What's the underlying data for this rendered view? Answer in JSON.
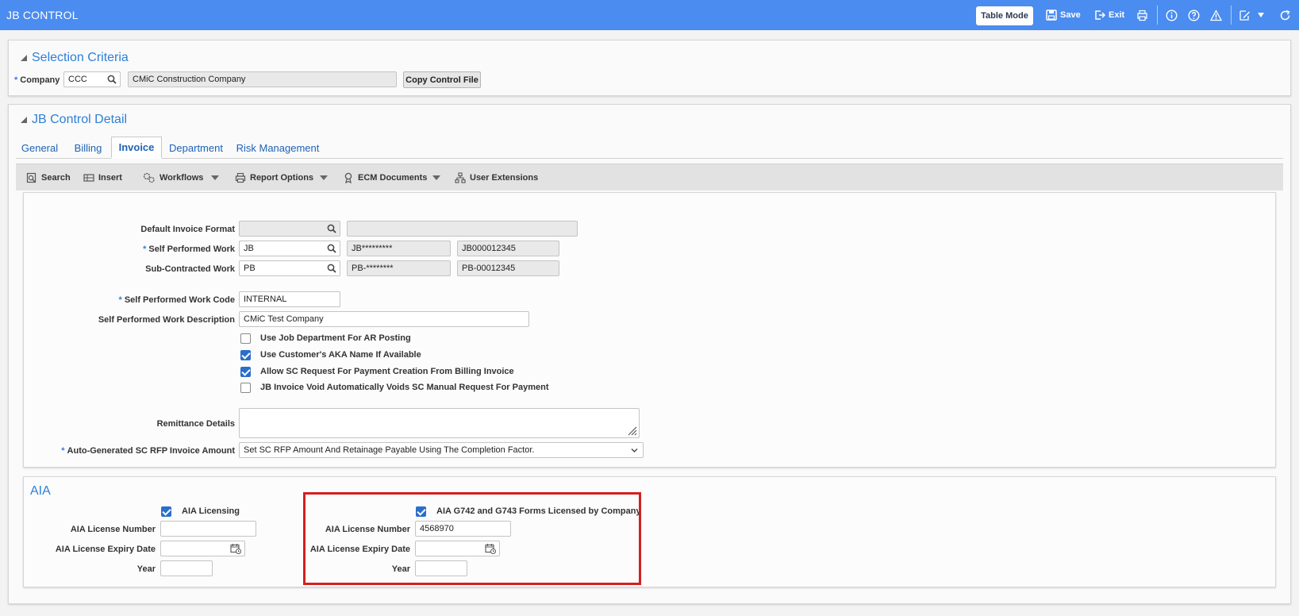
{
  "header": {
    "title": "JB CONTROL",
    "table_mode": "Table Mode",
    "save": "Save",
    "exit": "Exit"
  },
  "selection": {
    "title": "Selection Criteria",
    "company_label": "Company",
    "company_code": "CCC",
    "company_name": "CMiC Construction Company",
    "copy_button": "Copy Control File"
  },
  "detail": {
    "title": "JB Control Detail",
    "tabs": [
      "General",
      "Billing",
      "Invoice",
      "Department",
      "Risk Management"
    ],
    "toolbar": {
      "search": "Search",
      "insert": "Insert",
      "workflows": "Workflows",
      "report_options": "Report Options",
      "ecm_documents": "ECM Documents",
      "user_extensions": "User Extensions"
    }
  },
  "invoice": {
    "default_format_label": "Default Invoice Format",
    "default_format_value": "",
    "default_format_desc": "",
    "self_performed_label": "Self Performed Work",
    "self_performed_value": "JB",
    "self_performed_mask": "JB*********",
    "self_performed_example": "JB000012345",
    "subcontracted_label": "Sub-Contracted Work",
    "subcontracted_value": "PB",
    "subcontracted_mask": "PB-********",
    "subcontracted_example": "PB-00012345",
    "spw_code_label": "Self Performed Work Code",
    "spw_code_value": "INTERNAL",
    "spw_desc_label": "Self Performed Work Description",
    "spw_desc_value": "CMiC Test Company",
    "checkboxes": [
      {
        "label": "Use Job Department For AR Posting",
        "checked": false
      },
      {
        "label": "Use Customer's AKA Name If Available",
        "checked": true
      },
      {
        "label": "Allow SC Request For Payment Creation From Billing Invoice",
        "checked": true
      },
      {
        "label": "JB Invoice Void Automatically Voids SC Manual Request For Payment",
        "checked": false
      }
    ],
    "remittance_label": "Remittance Details",
    "remittance_value": "",
    "autogen_label": "Auto-Generated SC RFP Invoice Amount",
    "autogen_value": "Set SC RFP Amount And Retainage Payable Using The Completion Factor."
  },
  "aia": {
    "title": "AIA",
    "left": {
      "licensing_label": "AIA Licensing",
      "licensing_checked": true,
      "license_number_label": "AIA License Number",
      "license_number_value": "",
      "expiry_label": "AIA License Expiry Date",
      "expiry_value": "",
      "year_label": "Year",
      "year_value": ""
    },
    "right": {
      "forms_label": "AIA G742 and G743 Forms Licensed by Company",
      "forms_checked": true,
      "license_number_label": "AIA License Number",
      "license_number_value": "4568970",
      "expiry_label": "AIA License Expiry Date",
      "expiry_value": "",
      "year_label": "Year",
      "year_value": ""
    }
  },
  "colors": {
    "header_bg": "#4a8cf0",
    "accent": "#2f7fd8",
    "highlight_box": "#d41f1f"
  }
}
